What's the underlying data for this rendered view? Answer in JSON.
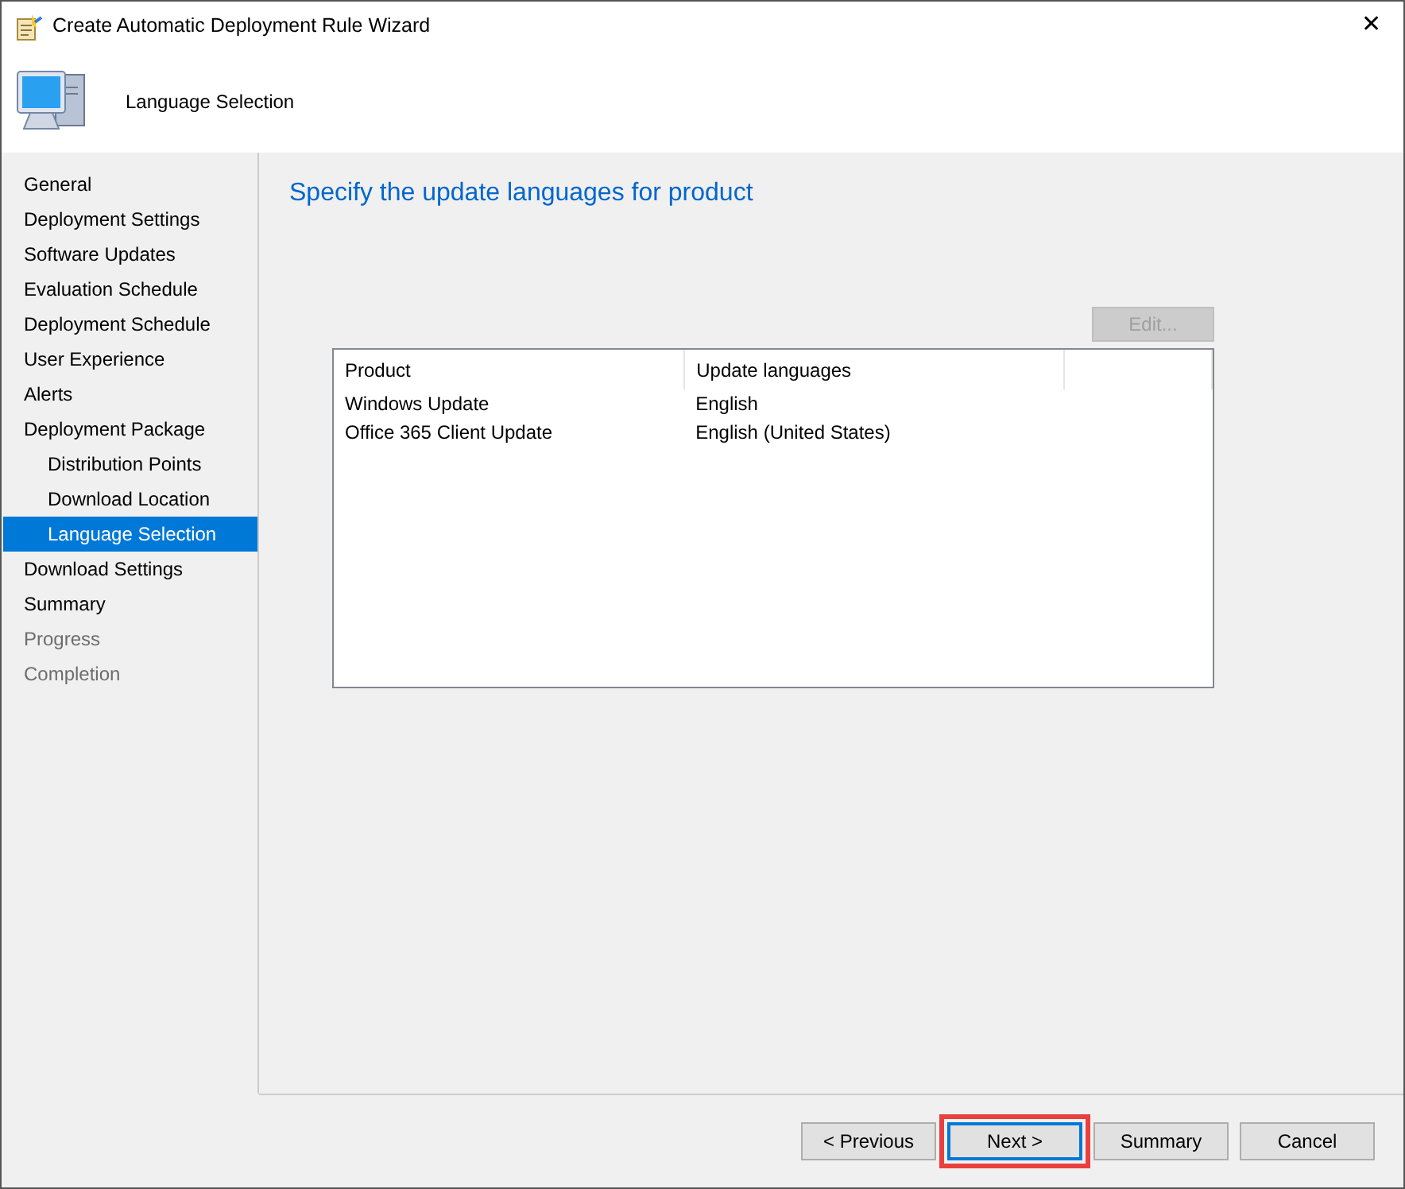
{
  "window": {
    "title": "Create Automatic Deployment Rule Wizard",
    "close": "✕"
  },
  "header": {
    "title": "Language Selection"
  },
  "steps": [
    {
      "label": "General",
      "selected": false,
      "disabled": false
    },
    {
      "label": "Deployment Settings",
      "selected": false,
      "disabled": false
    },
    {
      "label": "Software Updates",
      "selected": false,
      "disabled": false
    },
    {
      "label": "Evaluation Schedule",
      "selected": false,
      "disabled": false
    },
    {
      "label": "Deployment Schedule",
      "selected": false,
      "disabled": false
    },
    {
      "label": "User Experience",
      "selected": false,
      "disabled": false
    },
    {
      "label": "Alerts",
      "selected": false,
      "disabled": false
    },
    {
      "label": "Deployment Package",
      "selected": false,
      "disabled": false,
      "children": [
        {
          "label": "Distribution Points",
          "selected": false,
          "disabled": false
        },
        {
          "label": "Download Location",
          "selected": false,
          "disabled": false
        },
        {
          "label": "Language Selection",
          "selected": true,
          "disabled": false
        }
      ]
    },
    {
      "label": "Download Settings",
      "selected": false,
      "disabled": false
    },
    {
      "label": "Summary",
      "selected": false,
      "disabled": false
    },
    {
      "label": "Progress",
      "selected": false,
      "disabled": true
    },
    {
      "label": "Completion",
      "selected": false,
      "disabled": true
    }
  ],
  "page": {
    "heading": "Specify the update languages for product",
    "edit_button": {
      "label": "Edit...",
      "disabled": true
    },
    "table": {
      "columns": [
        "Product",
        "Update languages"
      ],
      "rows": [
        [
          "Windows Update",
          "English"
        ],
        [
          "Office 365 Client Update",
          "English (United States)"
        ]
      ]
    }
  },
  "buttons": [
    {
      "label": "< Previous",
      "default": false,
      "highlighted": false
    },
    {
      "label": "Next >",
      "default": true,
      "highlighted": true
    },
    {
      "label": "Summary",
      "default": false,
      "highlighted": false
    },
    {
      "label": "Cancel",
      "default": false,
      "highlighted": false
    }
  ]
}
